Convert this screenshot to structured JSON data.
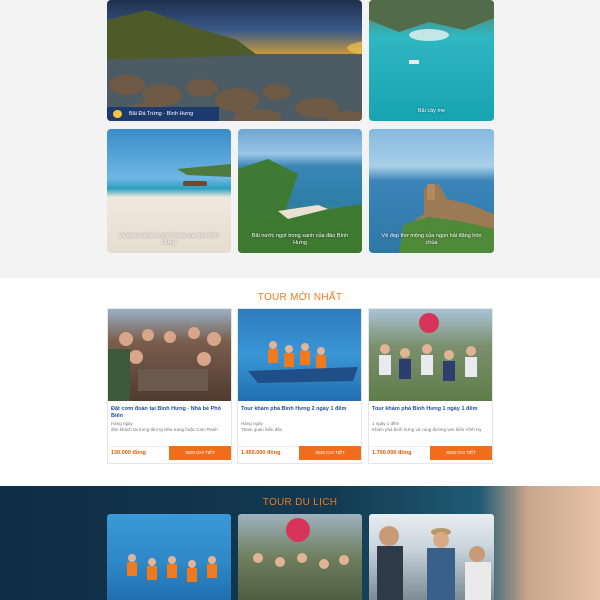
{
  "gallery": {
    "large_caption": "Bãi Đá Trứng - Bình Hưng",
    "top_right_caption": "Bãi cây me",
    "row2": [
      {
        "caption": "Vẻ đẹp hoang sơ thơ mộng của đảo Bình Hưng"
      },
      {
        "caption": "Bãi nước ngọt trong xanh của đảo Bình Hưng"
      },
      {
        "caption": "Vẻ đẹp thơ mộng của ngọn hải đăng hòn chùa"
      }
    ]
  },
  "newest": {
    "title": "TOUR MỚI NHẤT",
    "cards": [
      {
        "title": "Đặt cơm đoàn tại Bình Hưng - Nhà bè Phố Biển",
        "meta1": "Hàng ngày",
        "meta2": "đón khách tại trung tâm tp Nha trang hoặc Cam Ranh",
        "price": "130.000 đồng",
        "button": "XEM CHI TIẾT"
      },
      {
        "title": "Tour khám phá Bình Hưng 2 ngày 1 đêm",
        "meta1": "Hàng ngày",
        "meta2": "Tham quan biển đảo",
        "price": "1.450.000 đồng",
        "button": "XEM CHI TIẾT"
      },
      {
        "title": "Tour khám phá Bình Hưng 1 ngày 1 đêm",
        "meta1": "1 ngày 1 đêm",
        "meta2": "Khám phá bình hưng và cung đường ven biển Vĩnh Hy",
        "price": "1.700.000 đồng",
        "button": "XEM CHI TIẾT"
      }
    ]
  },
  "travel": {
    "title": "TOUR DU LỊCH"
  },
  "colors": {
    "accent_orange": "#f06d1c",
    "title_orange": "#f07a1c",
    "link_blue": "#1f4fa8"
  }
}
